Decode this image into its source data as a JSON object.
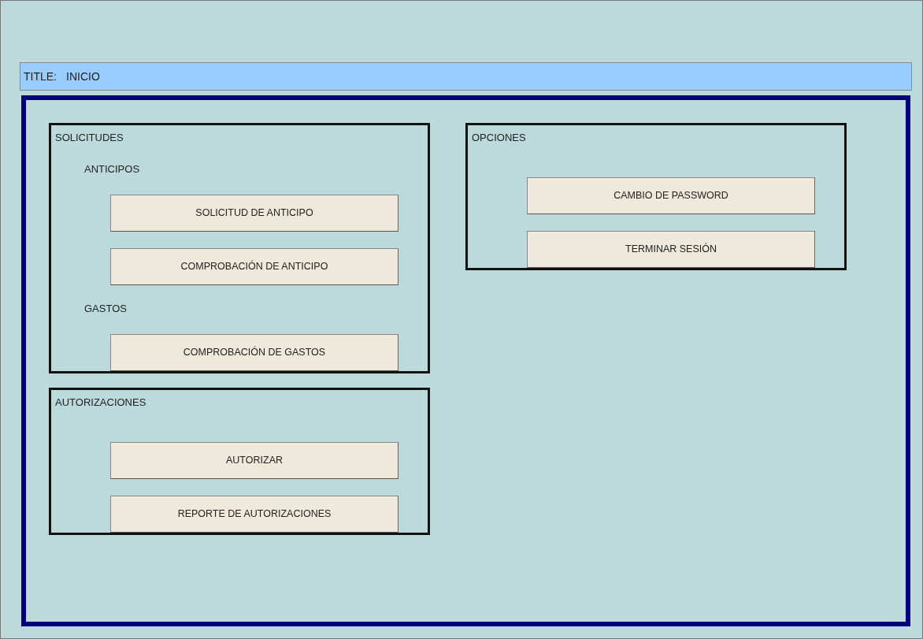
{
  "title_bar": {
    "label": "TITLE:",
    "value": "INICIO"
  },
  "left_panels": [
    {
      "title": "SOLICITUDES",
      "sections": [
        {
          "heading": "ANTICIPOS",
          "buttons": [
            "SOLICITUD DE ANTICIPO",
            "COMPROBACIÓN DE ANTICIPO"
          ]
        },
        {
          "heading": "GASTOS",
          "buttons": [
            "COMPROBACIÓN DE GASTOS"
          ]
        }
      ]
    },
    {
      "title": "AUTORIZACIONES",
      "sections": [
        {
          "buttons": [
            "AUTORIZAR",
            "REPORTE DE AUTORIZACIONES"
          ]
        }
      ]
    }
  ],
  "right_panels": [
    {
      "title": "OPCIONES",
      "sections": [
        {
          "buttons": [
            "CAMBIO DE PASSWORD",
            "TERMINAR SESIÓN"
          ]
        }
      ]
    }
  ]
}
